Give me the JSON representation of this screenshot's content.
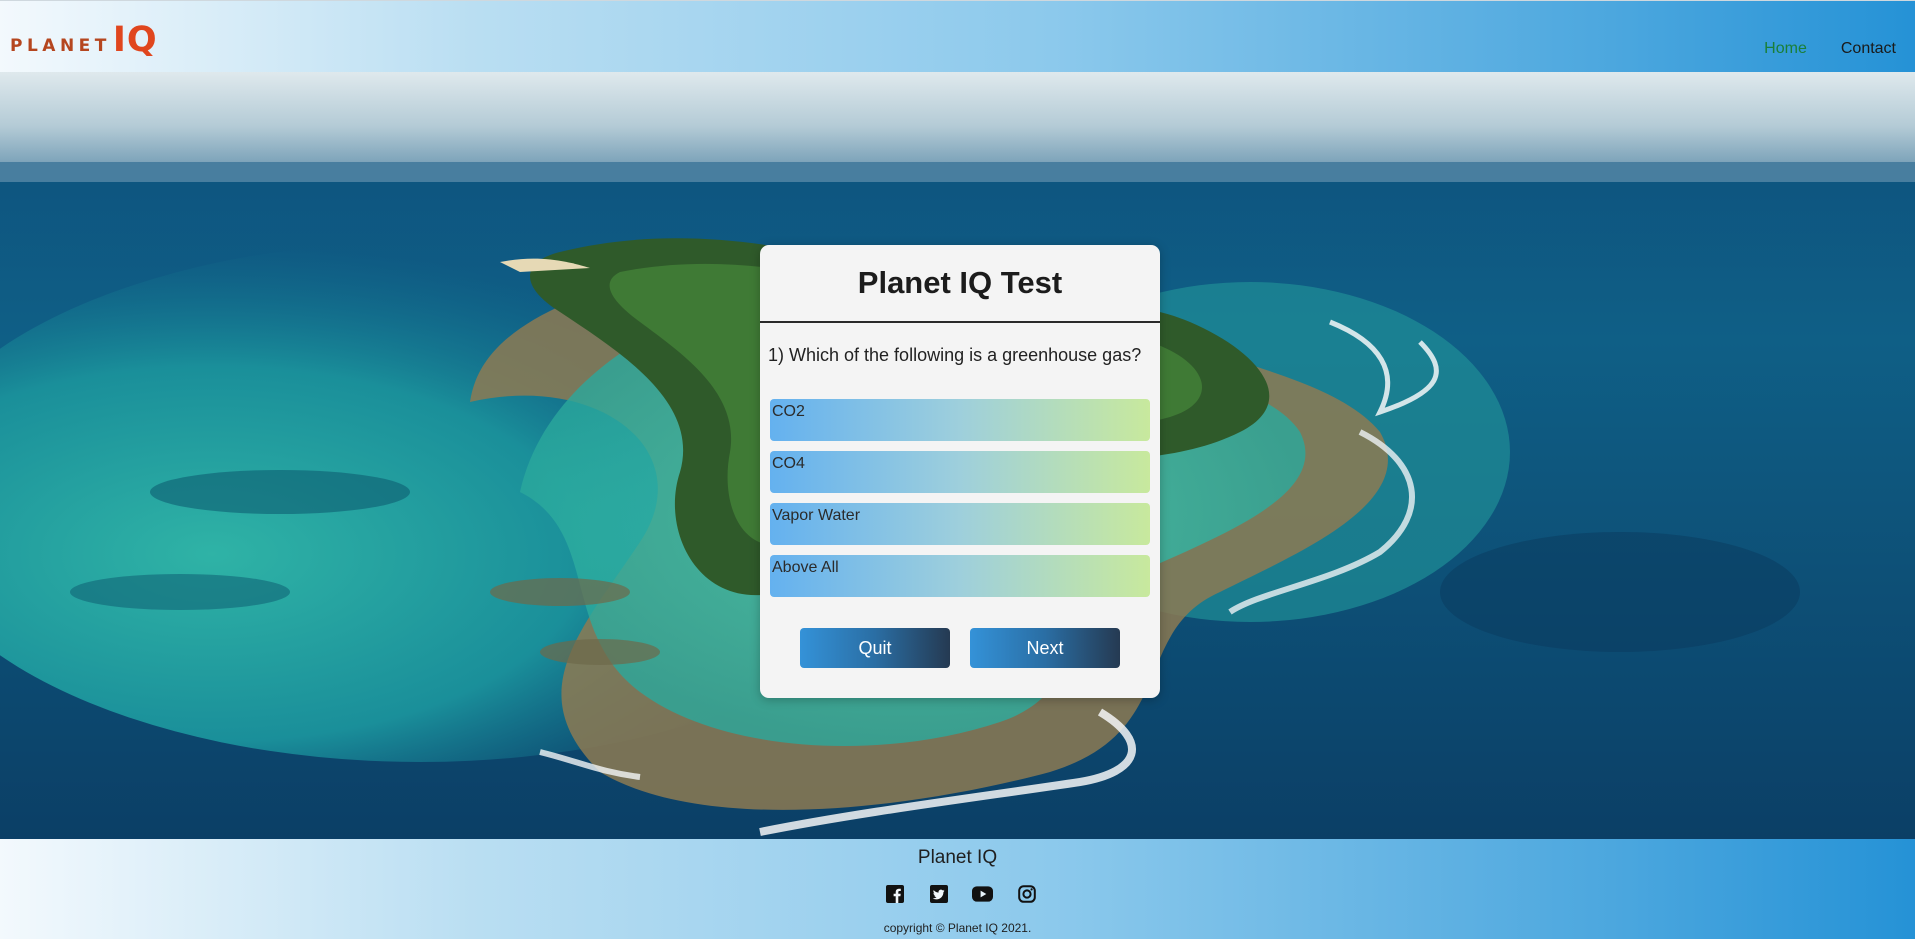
{
  "header": {
    "logo": {
      "planet": "PLANET",
      "iq": "IQ"
    },
    "nav": [
      {
        "label": "Home",
        "active": true
      },
      {
        "label": "Contact",
        "active": false
      }
    ]
  },
  "quiz": {
    "title": "Planet IQ Test",
    "question": "1) Which of the following is a greenhouse gas?",
    "options": [
      "CO2",
      "CO4",
      "Vapor Water",
      "Above All"
    ],
    "buttons": {
      "quit": "Quit",
      "next": "Next"
    }
  },
  "footer": {
    "title": "Planet IQ",
    "social_icons": [
      "facebook-icon",
      "twitter-icon",
      "youtube-icon",
      "instagram-icon"
    ],
    "copyright": "copyright © Planet IQ 2021."
  },
  "colors": {
    "logo": "#e0461e",
    "nav_active": "#1a7f37",
    "button_start": "#3492d8",
    "button_end": "#253a52",
    "option_start": "#64b1ef",
    "option_end": "#c8e99d"
  }
}
